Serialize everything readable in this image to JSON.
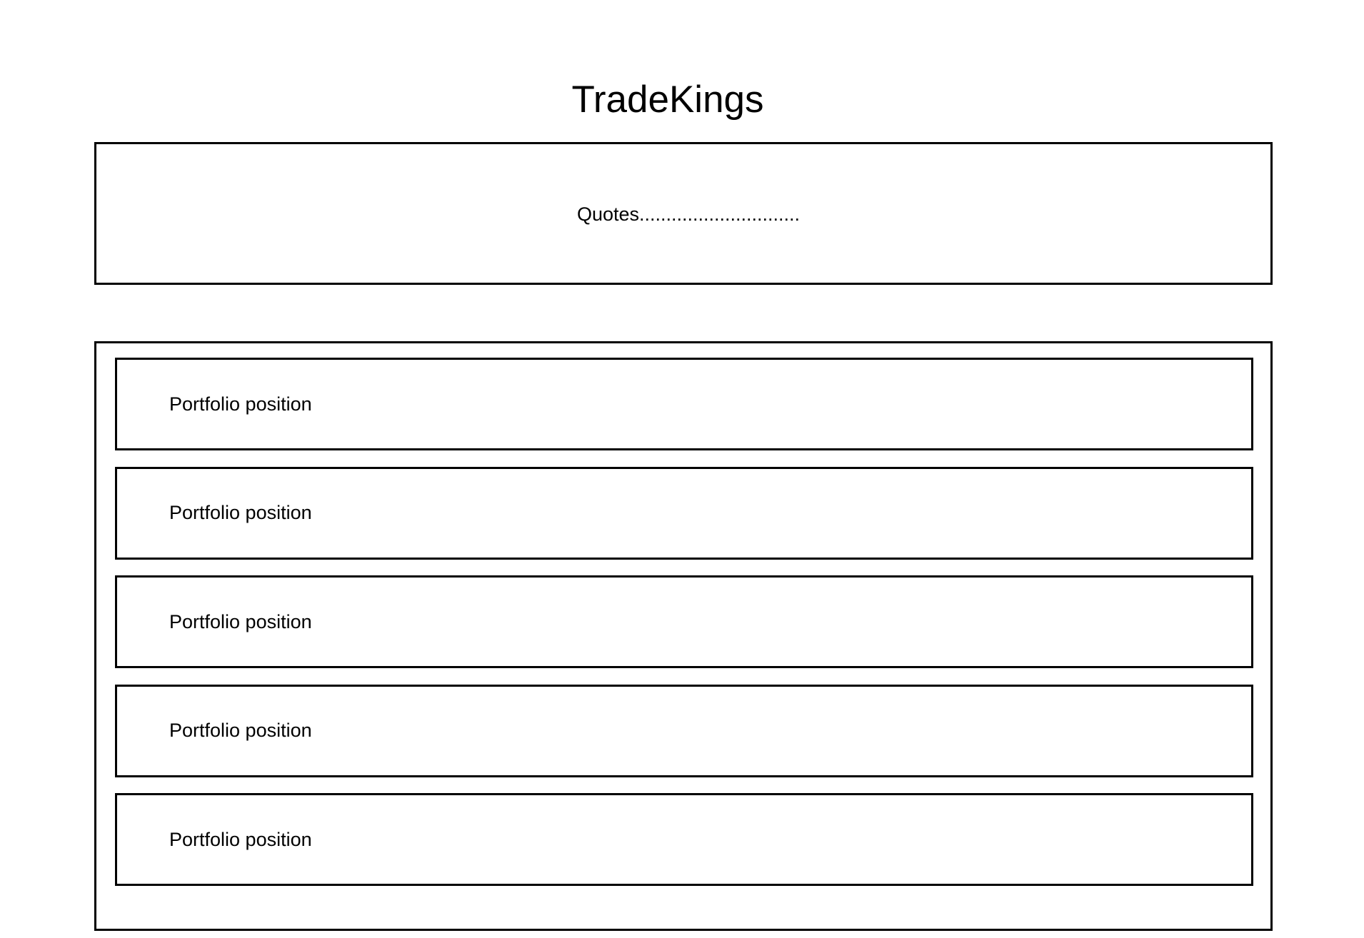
{
  "app": {
    "title": "TradeKings"
  },
  "quotes": {
    "text": "Quotes.............................."
  },
  "portfolio": {
    "positions": [
      {
        "label": "Portfolio position"
      },
      {
        "label": "Portfolio position"
      },
      {
        "label": "Portfolio position"
      },
      {
        "label": "Portfolio position"
      },
      {
        "label": "Portfolio position"
      }
    ]
  },
  "colors": {
    "border": "#000000",
    "background": "#ffffff",
    "text": "#000000"
  }
}
